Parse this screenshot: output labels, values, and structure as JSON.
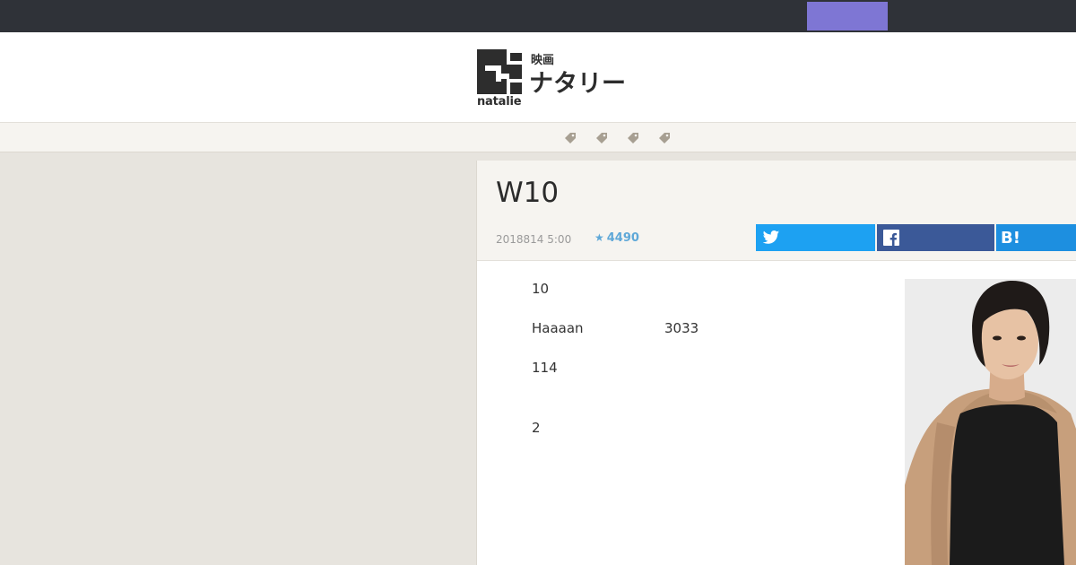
{
  "logo": {
    "category": "映画",
    "brand": "ナタリー",
    "wordmark": "natalie"
  },
  "tags": [
    {
      "icon": "tag-icon"
    },
    {
      "icon": "tag-icon"
    },
    {
      "icon": "tag-icon"
    },
    {
      "icon": "tag-icon"
    }
  ],
  "article": {
    "title": "W10",
    "date": "2018814 5:00",
    "stars": "4490",
    "body": {
      "p1": "10",
      "p2_left": "Haaaan",
      "p2_right": "3033",
      "p3": "114",
      "p4": "2"
    }
  },
  "share": {
    "twitter_icon": "twitter-icon",
    "facebook_icon": "facebook-icon",
    "hatena_label": "B!"
  },
  "colors": {
    "topbar": "#2f3238",
    "topbar_button": "#7e76d4",
    "twitter": "#1da1f2",
    "facebook": "#3b5998",
    "hatena": "#1d8fe0",
    "stars": "#5fa8d8"
  }
}
